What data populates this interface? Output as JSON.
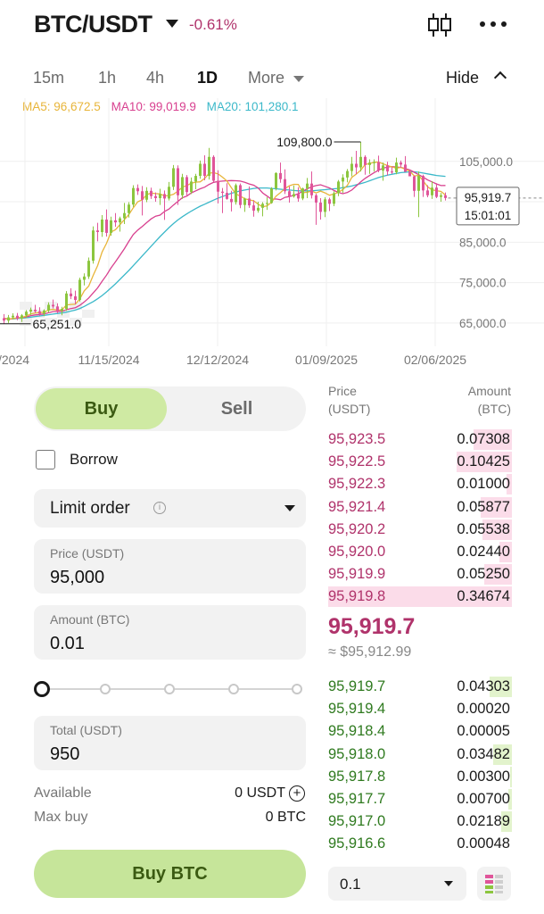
{
  "header": {
    "pair": "BTC/USDT",
    "change": "-0.61%"
  },
  "timeframes": {
    "items": [
      "15m",
      "1h",
      "4h",
      "1D"
    ],
    "active": "1D",
    "more_label": "More",
    "hide_label": "Hide"
  },
  "ma_legend": [
    {
      "label": "MA5: 96,672.5",
      "color": "#e8b53a"
    },
    {
      "label": "MA10: 99,019.9",
      "color": "#d8408f"
    },
    {
      "label": "MA20: 101,280.1",
      "color": "#3bb8c9"
    }
  ],
  "chart_data": {
    "type": "candlestick",
    "y_ticks": [
      "105,000.0",
      "95,000.0",
      "85,000.0",
      "75,000.0",
      "65,000.0"
    ],
    "x_ticks": [
      "/2024",
      "11/15/2024",
      "12/12/2024",
      "01/09/2025",
      "02/06/2025"
    ],
    "high_annotation": "109,800.0",
    "low_annotation": "65,251.0",
    "last_price": "95,919.7",
    "countdown": "15:01:01",
    "ylim": [
      61000,
      114000
    ],
    "up_color": "#8cc63f",
    "down_color": "#e0559a",
    "candles": [
      {
        "o": 66200,
        "h": 67200,
        "l": 64800,
        "c": 65600
      },
      {
        "o": 65600,
        "h": 67000,
        "l": 65000,
        "c": 66400
      },
      {
        "o": 66400,
        "h": 67400,
        "l": 65900,
        "c": 66800
      },
      {
        "o": 66800,
        "h": 67500,
        "l": 65700,
        "c": 66100
      },
      {
        "o": 66100,
        "h": 67200,
        "l": 65251,
        "c": 66900
      },
      {
        "o": 66900,
        "h": 68200,
        "l": 66200,
        "c": 67800
      },
      {
        "o": 67800,
        "h": 68800,
        "l": 67000,
        "c": 68300
      },
      {
        "o": 68300,
        "h": 69500,
        "l": 67500,
        "c": 67900
      },
      {
        "o": 67900,
        "h": 68900,
        "l": 66800,
        "c": 67300
      },
      {
        "o": 67300,
        "h": 68400,
        "l": 66700,
        "c": 68100
      },
      {
        "o": 68100,
        "h": 70100,
        "l": 67600,
        "c": 69500
      },
      {
        "o": 69500,
        "h": 70800,
        "l": 68600,
        "c": 69100
      },
      {
        "o": 69100,
        "h": 69900,
        "l": 67400,
        "c": 68000
      },
      {
        "o": 68000,
        "h": 69000,
        "l": 66900,
        "c": 68500
      },
      {
        "o": 68500,
        "h": 72900,
        "l": 68000,
        "c": 72300
      },
      {
        "o": 72300,
        "h": 73600,
        "l": 70900,
        "c": 71600
      },
      {
        "o": 71600,
        "h": 73000,
        "l": 69600,
        "c": 70700
      },
      {
        "o": 70700,
        "h": 76200,
        "l": 70300,
        "c": 75700
      },
      {
        "o": 75700,
        "h": 77300,
        "l": 74300,
        "c": 76500
      },
      {
        "o": 76500,
        "h": 81200,
        "l": 75900,
        "c": 80400
      },
      {
        "o": 80400,
        "h": 88900,
        "l": 79700,
        "c": 87900
      },
      {
        "o": 87900,
        "h": 89800,
        "l": 85200,
        "c": 87500
      },
      {
        "o": 87500,
        "h": 91700,
        "l": 86300,
        "c": 90600
      },
      {
        "o": 90600,
        "h": 93100,
        "l": 86400,
        "c": 87300
      },
      {
        "o": 87300,
        "h": 91300,
        "l": 86600,
        "c": 90400
      },
      {
        "o": 90400,
        "h": 92200,
        "l": 88800,
        "c": 89900
      },
      {
        "o": 89900,
        "h": 91300,
        "l": 87600,
        "c": 90900
      },
      {
        "o": 90900,
        "h": 94700,
        "l": 89500,
        "c": 92200
      },
      {
        "o": 92200,
        "h": 94900,
        "l": 91100,
        "c": 94300
      },
      {
        "o": 94300,
        "h": 99100,
        "l": 93700,
        "c": 98400
      },
      {
        "o": 98400,
        "h": 99300,
        "l": 96700,
        "c": 97600
      },
      {
        "o": 97600,
        "h": 98900,
        "l": 91600,
        "c": 95500
      },
      {
        "o": 95500,
        "h": 98600,
        "l": 94900,
        "c": 97700
      },
      {
        "o": 97700,
        "h": 98500,
        "l": 95700,
        "c": 96400
      },
      {
        "o": 96400,
        "h": 97300,
        "l": 95000,
        "c": 95900
      },
      {
        "o": 95900,
        "h": 98200,
        "l": 94200,
        "c": 96900
      },
      {
        "o": 96900,
        "h": 97800,
        "l": 90500,
        "c": 95800
      },
      {
        "o": 95800,
        "h": 99900,
        "l": 95300,
        "c": 98700
      },
      {
        "o": 98700,
        "h": 104100,
        "l": 97900,
        "c": 103300
      },
      {
        "o": 103300,
        "h": 104000,
        "l": 94200,
        "c": 96600
      },
      {
        "o": 96600,
        "h": 101900,
        "l": 95700,
        "c": 101100
      },
      {
        "o": 101100,
        "h": 101600,
        "l": 96300,
        "c": 97400
      },
      {
        "o": 97400,
        "h": 101000,
        "l": 96900,
        "c": 100000
      },
      {
        "o": 100000,
        "h": 101900,
        "l": 98100,
        "c": 101400
      },
      {
        "o": 101400,
        "h": 105200,
        "l": 100700,
        "c": 104400
      },
      {
        "o": 104400,
        "h": 106500,
        "l": 100300,
        "c": 101400
      },
      {
        "o": 101400,
        "h": 108300,
        "l": 100500,
        "c": 106100
      },
      {
        "o": 106100,
        "h": 106500,
        "l": 99900,
        "c": 100200
      },
      {
        "o": 100200,
        "h": 102800,
        "l": 94600,
        "c": 97500
      },
      {
        "o": 97500,
        "h": 98400,
        "l": 92200,
        "c": 97200
      },
      {
        "o": 97200,
        "h": 99600,
        "l": 95500,
        "c": 95700
      },
      {
        "o": 95700,
        "h": 97700,
        "l": 92600,
        "c": 94900
      },
      {
        "o": 94900,
        "h": 99500,
        "l": 94300,
        "c": 99100
      },
      {
        "o": 99100,
        "h": 99500,
        "l": 93400,
        "c": 94200
      },
      {
        "o": 94200,
        "h": 96000,
        "l": 92500,
        "c": 95800
      },
      {
        "o": 95800,
        "h": 98800,
        "l": 93500,
        "c": 94100
      },
      {
        "o": 94100,
        "h": 95400,
        "l": 91300,
        "c": 92800
      },
      {
        "o": 92800,
        "h": 95000,
        "l": 92300,
        "c": 93500
      },
      {
        "o": 93500,
        "h": 94900,
        "l": 91400,
        "c": 94500
      },
      {
        "o": 94500,
        "h": 96100,
        "l": 93000,
        "c": 94700
      },
      {
        "o": 94700,
        "h": 98600,
        "l": 94500,
        "c": 98300
      },
      {
        "o": 98300,
        "h": 102300,
        "l": 97800,
        "c": 102100
      },
      {
        "o": 102100,
        "h": 104700,
        "l": 99700,
        "c": 100600
      },
      {
        "o": 100600,
        "h": 103000,
        "l": 96900,
        "c": 97600
      },
      {
        "o": 97600,
        "h": 98800,
        "l": 94800,
        "c": 96300
      },
      {
        "o": 96300,
        "h": 99000,
        "l": 96000,
        "c": 96900
      },
      {
        "o": 96900,
        "h": 98600,
        "l": 95000,
        "c": 95800
      },
      {
        "o": 95800,
        "h": 98500,
        "l": 95400,
        "c": 98300
      },
      {
        "o": 98300,
        "h": 100900,
        "l": 95900,
        "c": 99500
      },
      {
        "o": 99500,
        "h": 102500,
        "l": 95800,
        "c": 96600
      },
      {
        "o": 96600,
        "h": 97000,
        "l": 89300,
        "c": 94800
      },
      {
        "o": 94800,
        "h": 95900,
        "l": 90600,
        "c": 92500
      },
      {
        "o": 92500,
        "h": 96100,
        "l": 91200,
        "c": 95600
      },
      {
        "o": 95600,
        "h": 96000,
        "l": 92700,
        "c": 94500
      },
      {
        "o": 94500,
        "h": 97600,
        "l": 93900,
        "c": 97100
      },
      {
        "o": 97100,
        "h": 100400,
        "l": 96400,
        "c": 100000
      },
      {
        "o": 100000,
        "h": 101800,
        "l": 97200,
        "c": 101000
      },
      {
        "o": 101000,
        "h": 103100,
        "l": 99800,
        "c": 102600
      },
      {
        "o": 102600,
        "h": 106100,
        "l": 101300,
        "c": 104400
      },
      {
        "o": 104400,
        "h": 107600,
        "l": 101800,
        "c": 103500
      },
      {
        "o": 103500,
        "h": 109800,
        "l": 102500,
        "c": 106100
      },
      {
        "o": 106100,
        "h": 106500,
        "l": 101700,
        "c": 104100
      },
      {
        "o": 104100,
        "h": 105500,
        "l": 101900,
        "c": 104700
      },
      {
        "o": 104700,
        "h": 105500,
        "l": 102500,
        "c": 104800
      },
      {
        "o": 104800,
        "h": 106400,
        "l": 102300,
        "c": 102700
      },
      {
        "o": 102700,
        "h": 104700,
        "l": 100200,
        "c": 104000
      },
      {
        "o": 104000,
        "h": 104900,
        "l": 101500,
        "c": 102500
      },
      {
        "o": 102500,
        "h": 103600,
        "l": 101900,
        "c": 102300
      },
      {
        "o": 102300,
        "h": 105900,
        "l": 101800,
        "c": 104700
      },
      {
        "o": 104700,
        "h": 105200,
        "l": 103400,
        "c": 104200
      },
      {
        "o": 104200,
        "h": 106300,
        "l": 103300,
        "c": 102400
      },
      {
        "o": 102400,
        "h": 102800,
        "l": 101400,
        "c": 101300
      },
      {
        "o": 101300,
        "h": 101500,
        "l": 96200,
        "c": 97700
      },
      {
        "o": 97700,
        "h": 102500,
        "l": 91200,
        "c": 101400
      },
      {
        "o": 101400,
        "h": 101700,
        "l": 96200,
        "c": 97800
      },
      {
        "o": 97800,
        "h": 99100,
        "l": 96100,
        "c": 96600
      },
      {
        "o": 96600,
        "h": 100100,
        "l": 95700,
        "c": 98500
      },
      {
        "o": 98500,
        "h": 99600,
        "l": 95900,
        "c": 96200
      },
      {
        "o": 96200,
        "h": 97200,
        "l": 95000,
        "c": 96600
      },
      {
        "o": 96600,
        "h": 97300,
        "l": 95300,
        "c": 95919.7
      }
    ],
    "ma5": [
      66200,
      66000,
      66130,
      66250,
      66360,
      66740,
      67240,
      67500,
      67580,
      67640,
      68220,
      68350,
      68210,
      68240,
      69480,
      69600,
      69660,
      70950,
      72960,
      74150,
      76800,
      79210,
      82580,
      84740,
      87520,
      88100,
      89340,
      90560,
      91840,
      93530,
      95010,
      95500,
      96760,
      97140,
      97010,
      96940,
      96440,
      96540,
      96860,
      97630,
      98600,
      99010,
      99600,
      99840,
      99940,
      100770,
      102060,
      102200,
      101870,
      101080,
      100140,
      98460,
      96900,
      96400,
      95740,
      95480,
      95220,
      94380,
      93760,
      94000,
      94880,
      96380,
      97280,
      98260,
      98960,
      99320,
      99300,
      97240,
      97380,
      97620,
      97200,
      97640,
      97200,
      96600,
      96920,
      97340,
      98040,
      99040,
      101040,
      101860,
      102800,
      104240,
      104460,
      104760,
      104820,
      104400,
      103960,
      103620,
      103280,
      103500,
      103040,
      102560,
      101380,
      101500,
      100180,
      98700,
      97940,
      97740,
      97540,
      96672.5
    ],
    "ma10": [
      66200,
      65900,
      66070,
      66250,
      66360,
      66500,
      66830,
      67000,
      67100,
      67240,
      67540,
      67830,
      67880,
      67900,
      68300,
      68580,
      68800,
      69380,
      70200,
      71200,
      72430,
      73700,
      75330,
      76850,
      78650,
      80150,
      81750,
      83400,
      85200,
      86900,
      88000,
      88900,
      89830,
      90770,
      91420,
      91700,
      92600,
      93200,
      94200,
      95100,
      96000,
      96400,
      97200,
      97700,
      98200,
      98600,
      99300,
      99800,
      100000,
      100100,
      100200,
      100250,
      100200,
      100100,
      99800,
      99400,
      99100,
      98400,
      97200,
      96400,
      95600,
      95700,
      95500,
      96100,
      96300,
      96600,
      97000,
      97600,
      98200,
      98700,
      99000,
      99200,
      98800,
      98400,
      97800,
      97300,
      97000,
      97300,
      97900,
      98900,
      99900,
      100800,
      101500,
      102200,
      102800,
      103300,
      103600,
      103700,
      103600,
      103500,
      103200,
      102900,
      102300,
      101700,
      101100,
      100400,
      99900,
      99400,
      99000,
      99019.9
    ],
    "ma20": [
      66200,
      66000,
      66000,
      66100,
      66200,
      66300,
      66450,
      66600,
      66750,
      66900,
      67050,
      67200,
      67350,
      67500,
      67700,
      67950,
      68200,
      68600,
      69100,
      69700,
      70300,
      71000,
      71800,
      72700,
      73700,
      74700,
      75800,
      76900,
      78000,
      79200,
      80400,
      81600,
      82800,
      84000,
      85200,
      86400,
      87500,
      88600,
      89600,
      90500,
      91300,
      92000,
      92700,
      93300,
      93900,
      94400,
      94900,
      95400,
      95900,
      96300,
      96700,
      97100,
      97400,
      97700,
      97900,
      98100,
      98300,
      98400,
      98400,
      98400,
      98300,
      98200,
      98100,
      98000,
      97900,
      97800,
      97700,
      97700,
      97700,
      97700,
      97800,
      97900,
      98000,
      98100,
      98200,
      98300,
      98500,
      98700,
      98900,
      99200,
      99500,
      99800,
      100200,
      100600,
      101000,
      101300,
      101600,
      101800,
      102000,
      102200,
      102300,
      102400,
      102400,
      102300,
      102100,
      101900,
      101700,
      101500,
      101400,
      101280.1
    ]
  },
  "order_form": {
    "side_buy": "Buy",
    "side_sell": "Sell",
    "borrow_label": "Borrow",
    "order_type": "Limit order",
    "price_label": "Price (USDT)",
    "price_value": "95,000",
    "amount_label": "Amount (BTC)",
    "amount_value": "0.01",
    "slider_fraction": 0,
    "total_label": "Total (USDT)",
    "total_value": "950",
    "available_label": "Available",
    "available_value": "0 USDT",
    "max_buy_label": "Max buy",
    "max_buy_value": "0 BTC",
    "buy_button": "Buy BTC"
  },
  "order_book": {
    "price_header_1": "Price",
    "price_header_2": "(USDT)",
    "amount_header_1": "Amount",
    "amount_header_2": "(BTC)",
    "asks": [
      {
        "price": "95,923.5",
        "amount": "0.07308",
        "depth": 0.21
      },
      {
        "price": "95,922.5",
        "amount": "0.10425",
        "depth": 0.3
      },
      {
        "price": "95,922.3",
        "amount": "0.01000",
        "depth": 0.03
      },
      {
        "price": "95,921.4",
        "amount": "0.05877",
        "depth": 0.17
      },
      {
        "price": "95,920.2",
        "amount": "0.05538",
        "depth": 0.16
      },
      {
        "price": "95,920.0",
        "amount": "0.02440",
        "depth": 0.07
      },
      {
        "price": "95,919.9",
        "amount": "0.05250",
        "depth": 0.15
      },
      {
        "price": "95,919.8",
        "amount": "0.34674",
        "depth": 1.0
      }
    ],
    "mid_price": "95,919.7",
    "mid_usd": "≈ $95,912.99",
    "bids": [
      {
        "price": "95,919.7",
        "amount": "0.04303",
        "depth": 0.12
      },
      {
        "price": "95,919.4",
        "amount": "0.00020",
        "depth": 0.0
      },
      {
        "price": "95,918.4",
        "amount": "0.00005",
        "depth": 0.0
      },
      {
        "price": "95,918.0",
        "amount": "0.03482",
        "depth": 0.1
      },
      {
        "price": "95,917.8",
        "amount": "0.00300",
        "depth": 0.01
      },
      {
        "price": "95,917.7",
        "amount": "0.00700",
        "depth": 0.02
      },
      {
        "price": "95,917.0",
        "amount": "0.02189",
        "depth": 0.06
      },
      {
        "price": "95,916.6",
        "amount": "0.00048",
        "depth": 0.0
      }
    ],
    "depth_value": "0.1"
  }
}
